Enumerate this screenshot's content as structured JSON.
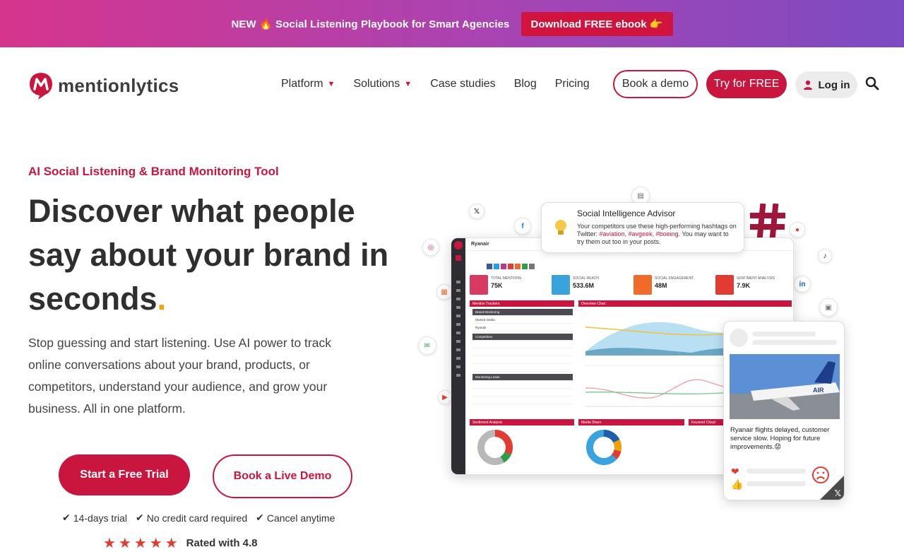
{
  "promo": {
    "text": "NEW 🔥 Social Listening Playbook for Smart Agencies",
    "button": "Download FREE ebook 👉"
  },
  "brand": {
    "name": "mentionlytics",
    "accent": "#c8163f",
    "highlight": "#f2a100"
  },
  "nav": {
    "items": [
      {
        "label": "Platform",
        "has_dropdown": true
      },
      {
        "label": "Solutions",
        "has_dropdown": true
      },
      {
        "label": "Case studies",
        "has_dropdown": false
      },
      {
        "label": "Blog",
        "has_dropdown": false
      },
      {
        "label": "Pricing",
        "has_dropdown": false
      }
    ],
    "book_demo": "Book a demo",
    "try_free": "Try for FREE",
    "login": "Log in",
    "search_icon": "search-icon"
  },
  "hero": {
    "eyebrow": "AI Social Listening & Brand Monitoring Tool",
    "title_main": "Discover what people say about your brand in seconds",
    "title_dot": ".",
    "description": "Stop guessing and start listening. Use AI power to track online conversations about your brand, products, or competitors, understand your audience, and grow your business. All in one platform.",
    "cta_trial": "Start a Free Trial",
    "cta_demo": "Book a Live Demo",
    "perks": [
      "14-days trial",
      "No credit card required",
      "Cancel anytime"
    ],
    "rated": "Rated with 4.8"
  },
  "illustration": {
    "advisor": {
      "title": "Social Intelligence Advisor",
      "body_prefix": "Your competitors use these high-performing hashtags on Twitter: ",
      "tags": "#aviation, #avgeek, #boeing",
      "body_suffix": ". You may want to try them out too in your posts."
    },
    "dashboard": {
      "brand": "Ryanair",
      "kpis": [
        {
          "label": "TOTAL MENTIONS",
          "value": "75K",
          "color": "#d83a64"
        },
        {
          "label": "SOCIAL REACH",
          "value": "533.6M",
          "color": "#3aa3de"
        },
        {
          "label": "SOCIAL ENGAGEMENT",
          "value": "48M",
          "color": "#f06b2a"
        },
        {
          "label": "SENTIMENT ANALYSIS",
          "value": "7.9K",
          "color": "#e23b31"
        }
      ],
      "panels": [
        "Mention Trackers",
        "Overview Chart",
        "Sentiment Analysis",
        "Media Share",
        "Keyword Cloud"
      ],
      "trackers": [
        "Brand Monitoring",
        "Owned media",
        "Ryanair",
        "Competitors",
        "Monitoring Leads"
      ]
    },
    "post": {
      "text": "Ryanair flights delayed, customer service slow. Hoping for future improvements.😟"
    }
  }
}
